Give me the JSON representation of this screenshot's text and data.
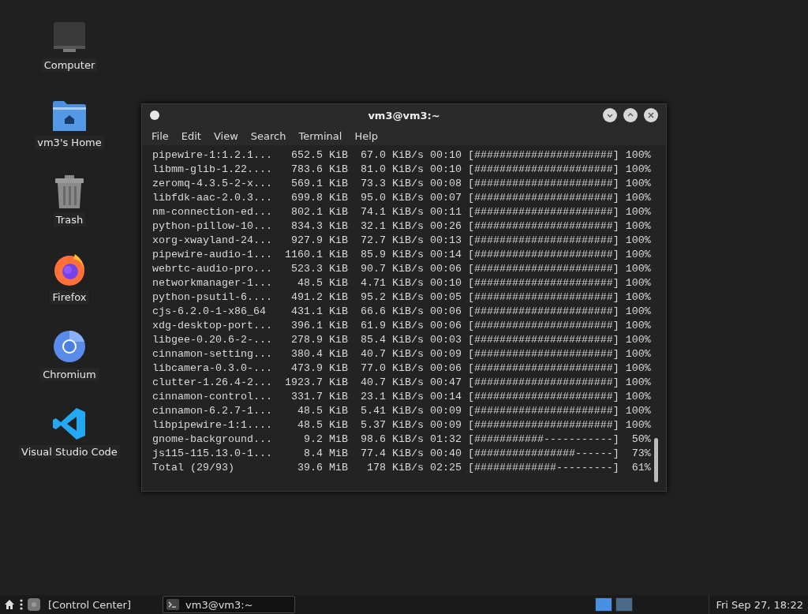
{
  "desktop_icons": [
    {
      "kind": "computer",
      "label": "Computer"
    },
    {
      "kind": "home",
      "label": "vm3's Home"
    },
    {
      "kind": "trash",
      "label": "Trash"
    },
    {
      "kind": "firefox",
      "label": "Firefox"
    },
    {
      "kind": "chromium",
      "label": "Chromium"
    },
    {
      "kind": "vscode",
      "label": "Visual Studio Code"
    }
  ],
  "window": {
    "title": "vm3@vm3:~",
    "menu": [
      "File",
      "Edit",
      "View",
      "Search",
      "Terminal",
      "Help"
    ],
    "lines": [
      {
        "name": "pipewire-1:1.2.1...",
        "size": "652.5 KiB",
        "speed": "67.0 KiB/s",
        "eta": "00:10",
        "bar": "[######################]",
        "percent": "100%"
      },
      {
        "name": "libmm-glib-1.22....",
        "size": "783.6 KiB",
        "speed": "81.0 KiB/s",
        "eta": "00:10",
        "bar": "[######################]",
        "percent": "100%"
      },
      {
        "name": "zeromq-4.3.5-2-x...",
        "size": "569.1 KiB",
        "speed": "73.3 KiB/s",
        "eta": "00:08",
        "bar": "[######################]",
        "percent": "100%"
      },
      {
        "name": "libfdk-aac-2.0.3...",
        "size": "699.8 KiB",
        "speed": "95.0 KiB/s",
        "eta": "00:07",
        "bar": "[######################]",
        "percent": "100%"
      },
      {
        "name": "nm-connection-ed...",
        "size": "802.1 KiB",
        "speed": "74.1 KiB/s",
        "eta": "00:11",
        "bar": "[######################]",
        "percent": "100%"
      },
      {
        "name": "python-pillow-10...",
        "size": "834.3 KiB",
        "speed": "32.1 KiB/s",
        "eta": "00:26",
        "bar": "[######################]",
        "percent": "100%"
      },
      {
        "name": "xorg-xwayland-24...",
        "size": "927.9 KiB",
        "speed": "72.7 KiB/s",
        "eta": "00:13",
        "bar": "[######################]",
        "percent": "100%"
      },
      {
        "name": "pipewire-audio-1...",
        "size": "1160.1 KiB",
        "speed": "85.9 KiB/s",
        "eta": "00:14",
        "bar": "[######################]",
        "percent": "100%"
      },
      {
        "name": "webrtc-audio-pro...",
        "size": "523.3 KiB",
        "speed": "90.7 KiB/s",
        "eta": "00:06",
        "bar": "[######################]",
        "percent": "100%"
      },
      {
        "name": "networkmanager-1...",
        "size": "48.5 KiB",
        "speed": "4.71 KiB/s",
        "eta": "00:10",
        "bar": "[######################]",
        "percent": "100%"
      },
      {
        "name": "python-psutil-6....",
        "size": "491.2 KiB",
        "speed": "95.2 KiB/s",
        "eta": "00:05",
        "bar": "[######################]",
        "percent": "100%"
      },
      {
        "name": "cjs-6.2.0-1-x86_64",
        "size": "431.1 KiB",
        "speed": "66.6 KiB/s",
        "eta": "00:06",
        "bar": "[######################]",
        "percent": "100%"
      },
      {
        "name": "xdg-desktop-port...",
        "size": "396.1 KiB",
        "speed": "61.9 KiB/s",
        "eta": "00:06",
        "bar": "[######################]",
        "percent": "100%"
      },
      {
        "name": "libgee-0.20.6-2-...",
        "size": "278.9 KiB",
        "speed": "85.4 KiB/s",
        "eta": "00:03",
        "bar": "[######################]",
        "percent": "100%"
      },
      {
        "name": "cinnamon-setting...",
        "size": "380.4 KiB",
        "speed": "40.7 KiB/s",
        "eta": "00:09",
        "bar": "[######################]",
        "percent": "100%"
      },
      {
        "name": "libcamera-0.3.0-...",
        "size": "473.9 KiB",
        "speed": "77.0 KiB/s",
        "eta": "00:06",
        "bar": "[######################]",
        "percent": "100%"
      },
      {
        "name": "clutter-1.26.4-2...",
        "size": "1923.7 KiB",
        "speed": "40.7 KiB/s",
        "eta": "00:47",
        "bar": "[######################]",
        "percent": "100%"
      },
      {
        "name": "cinnamon-control...",
        "size": "331.7 KiB",
        "speed": "23.1 KiB/s",
        "eta": "00:14",
        "bar": "[######################]",
        "percent": "100%"
      },
      {
        "name": "cinnamon-6.2.7-1...",
        "size": "48.5 KiB",
        "speed": "5.41 KiB/s",
        "eta": "00:09",
        "bar": "[######################]",
        "percent": "100%"
      },
      {
        "name": "libpipewire-1:1....",
        "size": "48.5 KiB",
        "speed": "5.37 KiB/s",
        "eta": "00:09",
        "bar": "[######################]",
        "percent": "100%"
      },
      {
        "name": "gnome-background...",
        "size": "9.2 MiB",
        "speed": "98.6 KiB/s",
        "eta": "01:32",
        "bar": "[###########-----------]",
        "percent": "50%"
      },
      {
        "name": "js115-115.13.0-1...",
        "size": "8.4 MiB",
        "speed": "77.4 KiB/s",
        "eta": "00:40",
        "bar": "[################------]",
        "percent": "73%"
      },
      {
        "name": "Total (29/93)",
        "size": "39.6 MiB",
        "speed": "178 KiB/s",
        "eta": "02:25",
        "bar": "[#############---------]",
        "percent": "61%"
      }
    ]
  },
  "taskbar": {
    "launcher": "[Control Center]",
    "window_button": "vm3@vm3:~",
    "workspaces": [
      {
        "selected": true
      },
      {
        "selected": false
      }
    ],
    "clock": "Fri Sep 27, 18:22"
  }
}
